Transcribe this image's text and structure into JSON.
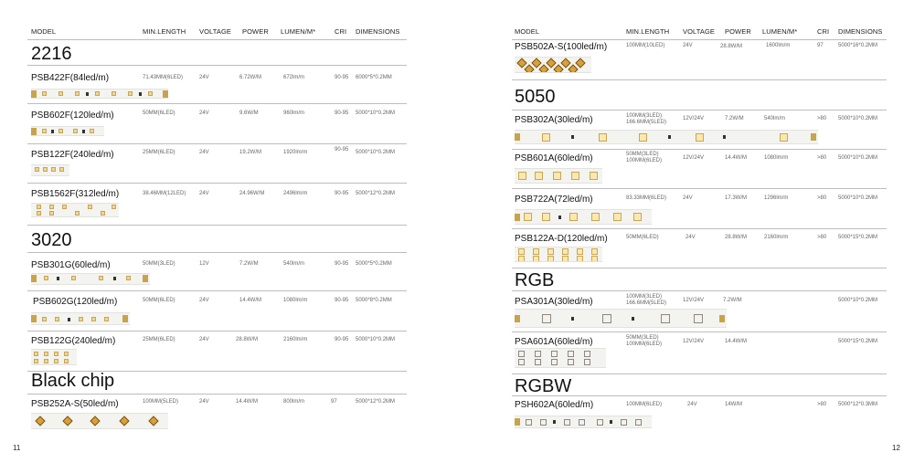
{
  "headers": {
    "model": "MODEL",
    "min_length": "MIN.LENGTH",
    "voltage": "VOLTAGE",
    "power": "POWER",
    "lumen": "LUMEN/M*",
    "cri": "CRI",
    "dimensions": "DIMENSIONS"
  },
  "left": {
    "page_number": "11",
    "sections": {
      "s2216": "2216",
      "s3020": "3020",
      "black": "Black chip"
    },
    "rows": [
      {
        "model": "PSB422F(84led/m)",
        "min": "71.43MM(6LED)",
        "volt": "24V",
        "power": "6.72W/M",
        "lumen": "672lm/m",
        "cri": "90-95",
        "dim": "6000*5*0.2MM"
      },
      {
        "model": "PSB602F(120led/m)",
        "min": "50MM(6LED)",
        "volt": "24V",
        "power": "9.6W/M",
        "lumen": "960lm/m",
        "cri": "90-95",
        "dim": "5000*10*0.2MM"
      },
      {
        "model": "PSB122F(240led/m)",
        "min": "25MM(6LED)",
        "volt": "24V",
        "power": "19.2W/M",
        "lumen": "1920lm/m",
        "cri": "90-95",
        "dim": "5000*10*0.2MM"
      },
      {
        "model": "PSB1562F(312led/m)",
        "min": "38.46MM(12LED)",
        "volt": "24V",
        "power": "24.96W/M",
        "lumen": "2496lm/m",
        "cri": "90-95",
        "dim": "5000*12*0.2MM"
      },
      {
        "model": "PSB301G(60led/m)",
        "min": "50MM(3LED)",
        "volt": "12V",
        "power": "7.2W/M",
        "lumen": "540lm/m",
        "cri": "90-95",
        "dim": "5000*5*0.2MM"
      },
      {
        "model": "PSB602G(120led/m)",
        "min": "50MM(6LED)",
        "volt": "24V",
        "power": "14.4W/M",
        "lumen": "1080lm/m",
        "cri": "90-95",
        "dim": "5000*8*0.2MM"
      },
      {
        "model": "PSB122G(240led/m)",
        "min": "25MM(6LED)",
        "volt": "24V",
        "power": "28.8W/M",
        "lumen": "2160lm/m",
        "cri": "90-95",
        "dim": "5000*10*0.2MM"
      },
      {
        "model": "PSB252A-S(50led/m)",
        "min": "100MM(5LED)",
        "volt": "24V",
        "power": "14.4W/M",
        "lumen": "800lm/m",
        "cri": "97",
        "dim": "5000*12*0.2MM"
      }
    ]
  },
  "right": {
    "page_number": "12",
    "sections": {
      "s5050": "5050",
      "rgb": "RGB",
      "rgbw": "RGBW"
    },
    "rows": [
      {
        "model": "PSB502A-S(100led/m)",
        "min": "100MM(10LED)",
        "volt": "24V",
        "power": "28.8W/M",
        "lumen": "1600lm/m",
        "cri": "97",
        "dim": "5000*16*0.2MM"
      },
      {
        "model": "PSB302A(30led/m)",
        "min": "100MM(3LED)",
        "min2": "166.6MM(5LED)",
        "volt": "12V/24V",
        "power": "7.2W/M",
        "lumen": "540lm/m",
        "cri": ">80",
        "dim": "5000*10*0.2MM"
      },
      {
        "model": "PSB601A(60led/m)",
        "min": "50MM(3LED)",
        "min2": "100MM(6LED)",
        "volt": "12V/24V",
        "power": "14.4W/M",
        "lumen": "1080lm/m",
        "cri": ">80",
        "dim": "5000*10*0.2MM"
      },
      {
        "model": "PSB722A(72led/m)",
        "min": "83.33MM(6LED)",
        "volt": "24V",
        "power": "17.3W/M",
        "lumen": "1296lm/m",
        "cri": ">80",
        "dim": "5000*10*0.2MM"
      },
      {
        "model": "PSB122A-D(120led/m)",
        "min": "50MM(6LED)",
        "volt": "24V",
        "power": "28.8W/M",
        "lumen": "2160lm/m",
        "cri": ">80",
        "dim": "5000*15*0.2MM"
      },
      {
        "model": "PSA301A(30led/m)",
        "min": "100MM(3LED)",
        "min2": "166.6MM(5LED)",
        "volt": "12V/24V",
        "power": "7.2W/M",
        "lumen": "",
        "cri": "",
        "dim": "5000*10*0.2MM"
      },
      {
        "model": "PSA601A(60led/m)",
        "min": "50MM(3LED)",
        "min2": "100MM(6LED)",
        "volt": "12V/24V",
        "power": "14.4W/M",
        "lumen": "",
        "cri": "",
        "dim": "5000*15*0.2MM"
      },
      {
        "model": "PSH602A(60led/m)",
        "min": "100MM(6LED)",
        "volt": "24V",
        "power": "14W/M",
        "lumen": "",
        "cri": ">80",
        "dim": "5000*12*0.3MM"
      }
    ]
  }
}
